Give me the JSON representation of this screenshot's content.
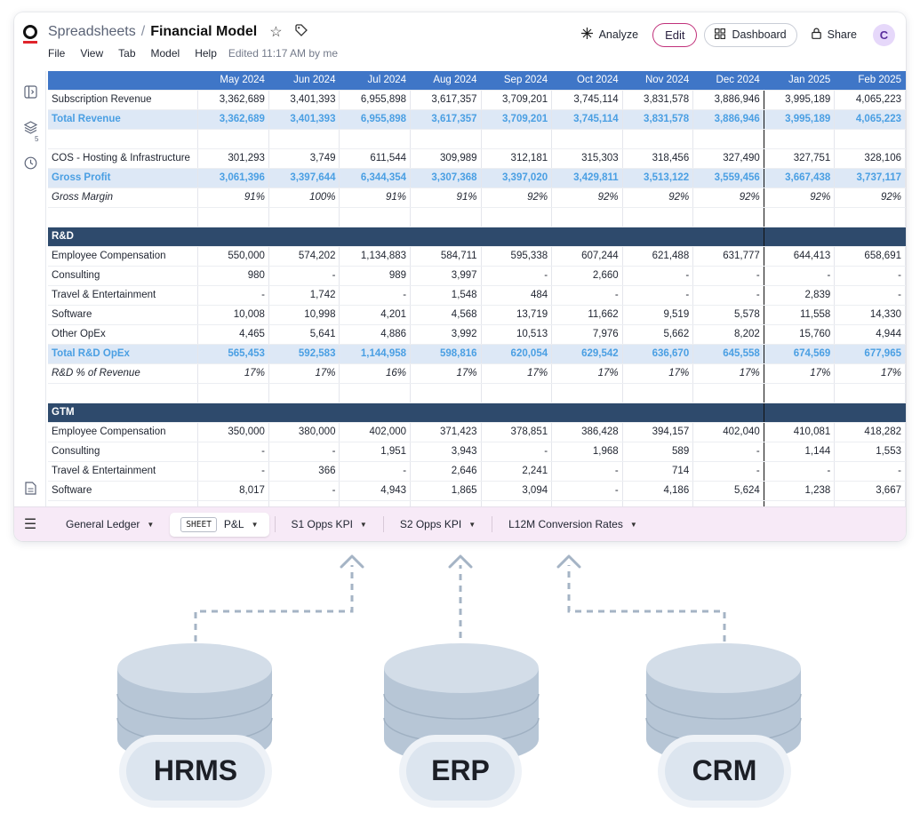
{
  "header": {
    "breadcrumb_root": "Spreadsheets",
    "breadcrumb_sep": "/",
    "title": "Financial Model",
    "menu": [
      "File",
      "View",
      "Tab",
      "Model",
      "Help"
    ],
    "edited": "Edited 11:17 AM by me",
    "analyze": "Analyze",
    "edit": "Edit",
    "dashboard": "Dashboard",
    "share": "Share",
    "avatar": "C"
  },
  "sidebar": {
    "badge": "5"
  },
  "table": {
    "months": [
      "May 2024",
      "Jun 2024",
      "Jul 2024",
      "Aug 2024",
      "Sep 2024",
      "Oct 2024",
      "Nov 2024",
      "Dec 2024",
      "Jan 2025",
      "Feb 2025"
    ],
    "rows": [
      {
        "type": "data",
        "label": "Subscription Revenue",
        "values": [
          "3,362,689",
          "3,401,393",
          "6,955,898",
          "3,617,357",
          "3,709,201",
          "3,745,114",
          "3,831,578",
          "3,886,946",
          "3,995,189",
          "4,065,223"
        ]
      },
      {
        "type": "total",
        "label": "Total Revenue",
        "values": [
          "3,362,689",
          "3,401,393",
          "6,955,898",
          "3,617,357",
          "3,709,201",
          "3,745,114",
          "3,831,578",
          "3,886,946",
          "3,995,189",
          "4,065,223"
        ]
      },
      {
        "type": "blank",
        "label": "",
        "values": [
          "",
          "",
          "",
          "",
          "",
          "",
          "",
          "",
          "",
          ""
        ]
      },
      {
        "type": "data",
        "label": "COS - Hosting & Infrastructure",
        "values": [
          "301,293",
          "3,749",
          "611,544",
          "309,989",
          "312,181",
          "315,303",
          "318,456",
          "327,490",
          "327,751",
          "328,106"
        ]
      },
      {
        "type": "total",
        "label": "Gross Profit",
        "values": [
          "3,061,396",
          "3,397,644",
          "6,344,354",
          "3,307,368",
          "3,397,020",
          "3,429,811",
          "3,513,122",
          "3,559,456",
          "3,667,438",
          "3,737,117"
        ]
      },
      {
        "type": "pct",
        "label": "Gross Margin",
        "values": [
          "91%",
          "100%",
          "91%",
          "91%",
          "92%",
          "92%",
          "92%",
          "92%",
          "92%",
          "92%"
        ]
      },
      {
        "type": "blank",
        "label": "",
        "values": [
          "",
          "",
          "",
          "",
          "",
          "",
          "",
          "",
          "",
          ""
        ]
      },
      {
        "type": "section",
        "label": "R&D",
        "values": [
          "",
          "",
          "",
          "",
          "",
          "",
          "",
          "",
          "",
          ""
        ]
      },
      {
        "type": "data",
        "label": "Employee Compensation",
        "values": [
          "550,000",
          "574,202",
          "1,134,883",
          "584,711",
          "595,338",
          "607,244",
          "621,488",
          "631,777",
          "644,413",
          "658,691"
        ]
      },
      {
        "type": "data",
        "label": "Consulting",
        "values": [
          "980",
          "-",
          "989",
          "3,997",
          "-",
          "2,660",
          "-",
          "-",
          "-",
          "-"
        ]
      },
      {
        "type": "data",
        "label": "Travel & Entertainment",
        "values": [
          "-",
          "1,742",
          "-",
          "1,548",
          "484",
          "-",
          "-",
          "-",
          "2,839",
          "-"
        ]
      },
      {
        "type": "data",
        "label": "Software",
        "values": [
          "10,008",
          "10,998",
          "4,201",
          "4,568",
          "13,719",
          "11,662",
          "9,519",
          "5,578",
          "11,558",
          "14,330"
        ]
      },
      {
        "type": "data",
        "label": "Other OpEx",
        "values": [
          "4,465",
          "5,641",
          "4,886",
          "3,992",
          "10,513",
          "7,976",
          "5,662",
          "8,202",
          "15,760",
          "4,944"
        ]
      },
      {
        "type": "total",
        "label": "Total R&D OpEx",
        "values": [
          "565,453",
          "592,583",
          "1,144,958",
          "598,816",
          "620,054",
          "629,542",
          "636,670",
          "645,558",
          "674,569",
          "677,965"
        ]
      },
      {
        "type": "pct",
        "label": "R&D % of Revenue",
        "values": [
          "17%",
          "17%",
          "16%",
          "17%",
          "17%",
          "17%",
          "17%",
          "17%",
          "17%",
          "17%"
        ]
      },
      {
        "type": "blank",
        "label": "",
        "values": [
          "",
          "",
          "",
          "",
          "",
          "",
          "",
          "",
          "",
          ""
        ]
      },
      {
        "type": "section",
        "label": "GTM",
        "values": [
          "",
          "",
          "",
          "",
          "",
          "",
          "",
          "",
          "",
          ""
        ]
      },
      {
        "type": "data",
        "label": "Employee Compensation",
        "values": [
          "350,000",
          "380,000",
          "402,000",
          "371,423",
          "378,851",
          "386,428",
          "394,157",
          "402,040",
          "410,081",
          "418,282"
        ]
      },
      {
        "type": "data",
        "label": "Consulting",
        "values": [
          "-",
          "-",
          "1,951",
          "3,943",
          "-",
          "1,968",
          "589",
          "-",
          "1,144",
          "1,553"
        ]
      },
      {
        "type": "data",
        "label": "Travel & Entertainment",
        "values": [
          "-",
          "366",
          "-",
          "2,646",
          "2,241",
          "-",
          "714",
          "-",
          "-",
          "-"
        ]
      },
      {
        "type": "data",
        "label": "Software",
        "values": [
          "8,017",
          "-",
          "4,943",
          "1,865",
          "3,094",
          "-",
          "4,186",
          "5,624",
          "1,238",
          "3,667"
        ]
      },
      {
        "type": "blank",
        "label": "",
        "values": [
          "",
          "",
          "",
          "",
          "",
          "",
          "",
          "",
          "",
          ""
        ]
      }
    ]
  },
  "tabs": [
    {
      "label": "General Ledger",
      "active": false
    },
    {
      "label": "P&L",
      "active": true,
      "tag": "SHEET"
    },
    {
      "label": "S1 Opps KPI",
      "active": false
    },
    {
      "label": "S2 Opps KPI",
      "active": false
    },
    {
      "label": "L12M Conversion Rates",
      "active": false
    }
  ],
  "sources": [
    "HRMS",
    "ERP",
    "CRM"
  ],
  "colors": {
    "header_blue": "#3f76c7",
    "total_text": "#4a9fe3",
    "total_bg": "#dde8f6",
    "section_bg": "#2e4a6c",
    "tabbar_bg": "#f7eaf7",
    "edit_border": "#c0307a",
    "database": "#bccbd9"
  }
}
